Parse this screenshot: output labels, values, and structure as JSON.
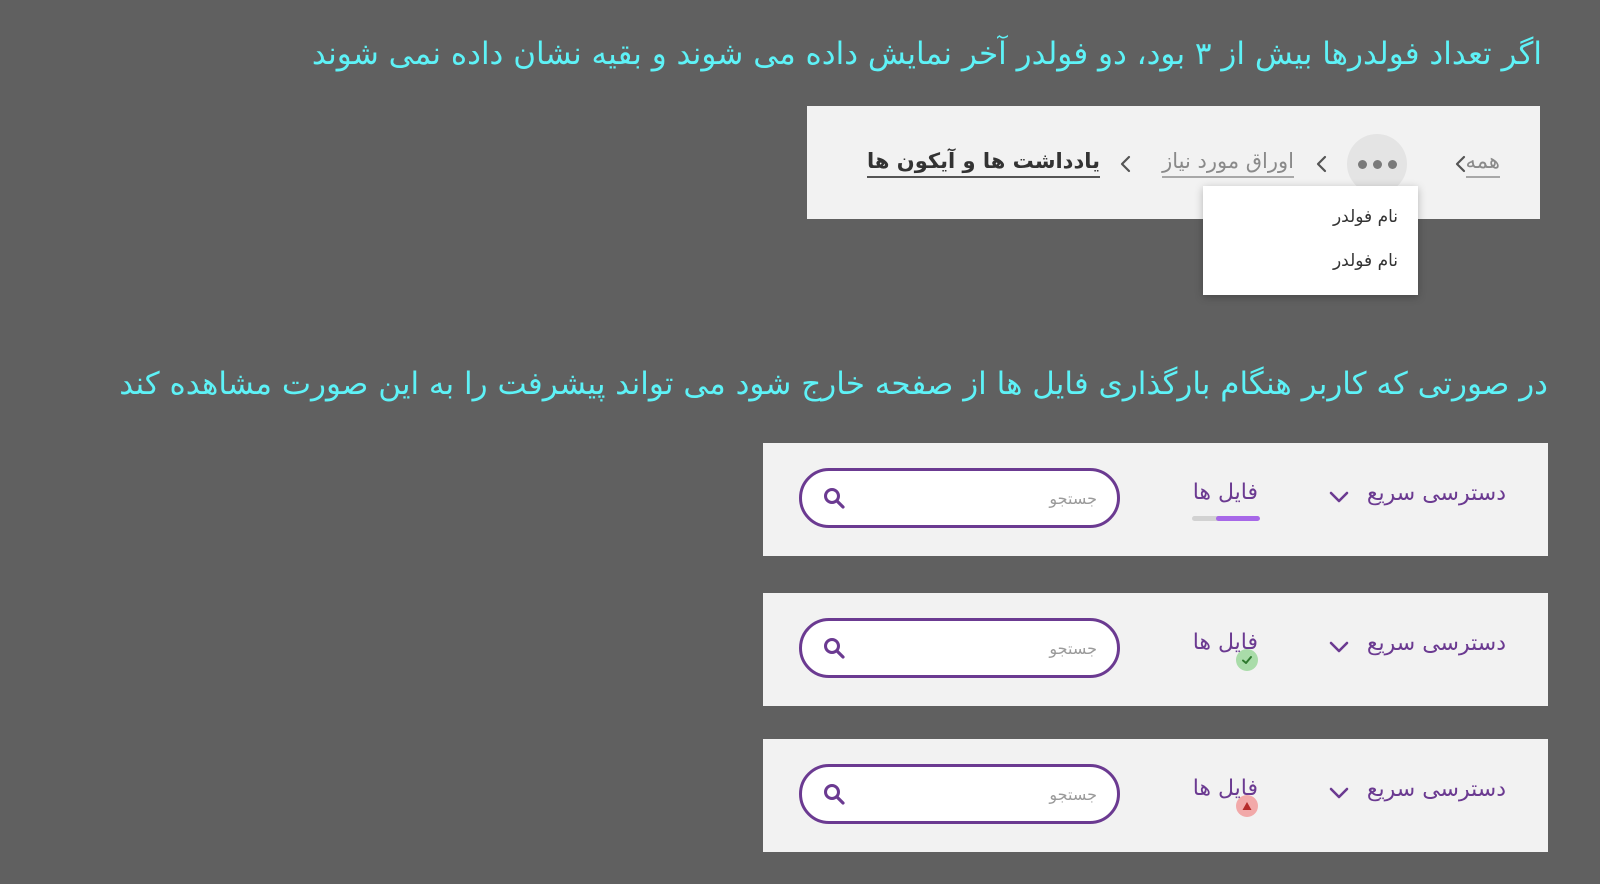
{
  "headings": {
    "breadcrumb_note": "اگر تعداد فولدرها بیش از ۳ بود، دو فولدر آخر نمایش داده می شوند و بقیه نشان داده نمی شوند",
    "upload_note": "در صورتی که کاربر هنگام بارگذاری فایل ها از صفحه خارج شود می تواند پیشرفت را به این صورت مشاهده کند"
  },
  "breadcrumb": {
    "items": [
      "همه",
      "اوراق مورد نیاز",
      "یادداشت ها و آیکون ها"
    ],
    "more_icon": "more-horizontal-icon",
    "separator_icon": "chevron-left-icon"
  },
  "dropdown": {
    "items": [
      "نام فولدر",
      "نام فولدر"
    ]
  },
  "toolbars": [
    {
      "quick_access": "دسترسی سریع",
      "files": "فایل ها",
      "status": "uploading",
      "progress": 0.65,
      "search_placeholder": "جستجو"
    },
    {
      "quick_access": "دسترسی سریع",
      "files": "فایل ها",
      "status": "success",
      "status_icon": "check-icon",
      "search_placeholder": "جستجو"
    },
    {
      "quick_access": "دسترسی سریع",
      "files": "فایل ها",
      "status": "error",
      "status_icon": "warning-triangle-icon",
      "search_placeholder": "جستجو"
    }
  ],
  "colors": {
    "background": "#606060",
    "heading": "#5ef2f7",
    "accent": "#6b3a91",
    "progress": "#a768e8",
    "success": "#a9dca9",
    "error": "#f2a9a9"
  }
}
